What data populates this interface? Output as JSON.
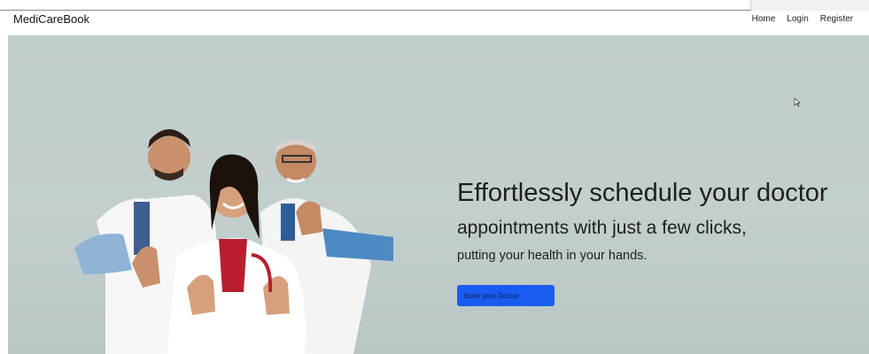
{
  "brand": {
    "name": "MediCareBook"
  },
  "nav": {
    "home": "Home",
    "login": "Login",
    "register": "Register"
  },
  "hero": {
    "headline": "Effortlessly schedule your doctor",
    "subheadline": "appointments with just a few clicks,",
    "tagline": "putting your health in your hands.",
    "cta_label": "Book your Doctor",
    "image": "doctors-thumbs-up-photo"
  },
  "colors": {
    "hero_bg": "#c0cdcd",
    "cta_bg": "#1a5cf2",
    "navbar_bg": "#ffffff"
  }
}
